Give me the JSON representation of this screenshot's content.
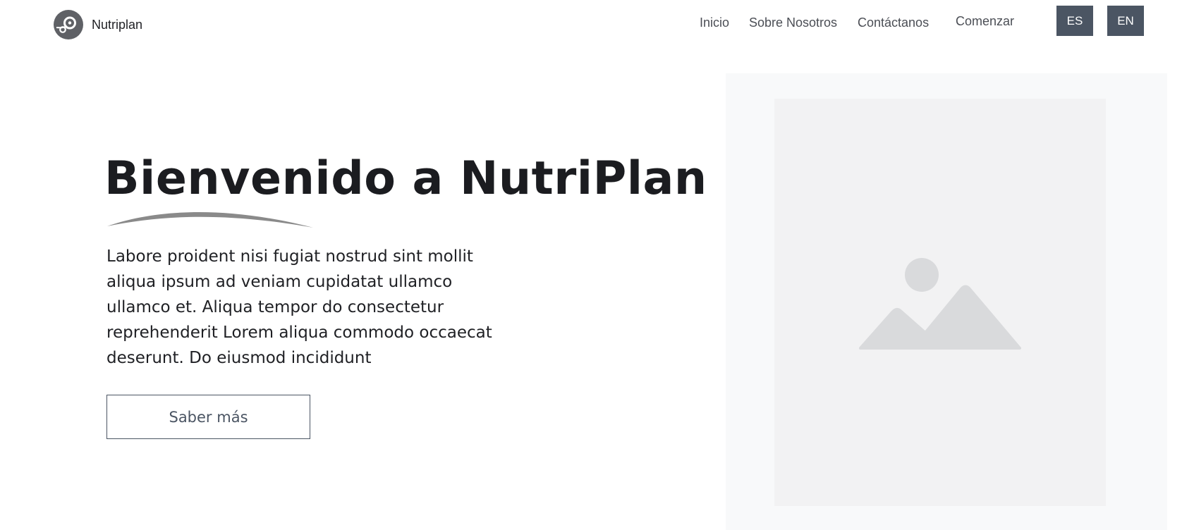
{
  "brand": {
    "name": "Nutriplan",
    "logo_icon": "nutriplan-logo-icon"
  },
  "nav": {
    "items": [
      {
        "label": "Inicio"
      },
      {
        "label": "Sobre Nosotros"
      },
      {
        "label": "Contáctanos"
      },
      {
        "label": "Comenzar"
      }
    ],
    "languages": [
      "ES",
      "EN"
    ]
  },
  "hero": {
    "title": "Bienvenido a NutriPlan",
    "description": "Labore proident nisi fugiat nostrud sint mollit aliqua ipsum ad veniam cupidatat ullamco ullamco et. Aliqua tempor do consectetur reprehenderit Lorem aliqua commodo occaecat deserunt. Do eiusmod incididunt",
    "cta_label": "Saber más"
  },
  "media": {
    "icon": "image-placeholder-icon"
  },
  "colors": {
    "text_dark": "#1b1c20",
    "text_muted": "#4b5563",
    "lang_button_bg": "#4b5563",
    "swoosh": "#8a8a8a",
    "placeholder_outer": "#f8f9fa",
    "placeholder_inner": "#f2f2f3",
    "placeholder_icon": "#d9dadc"
  }
}
